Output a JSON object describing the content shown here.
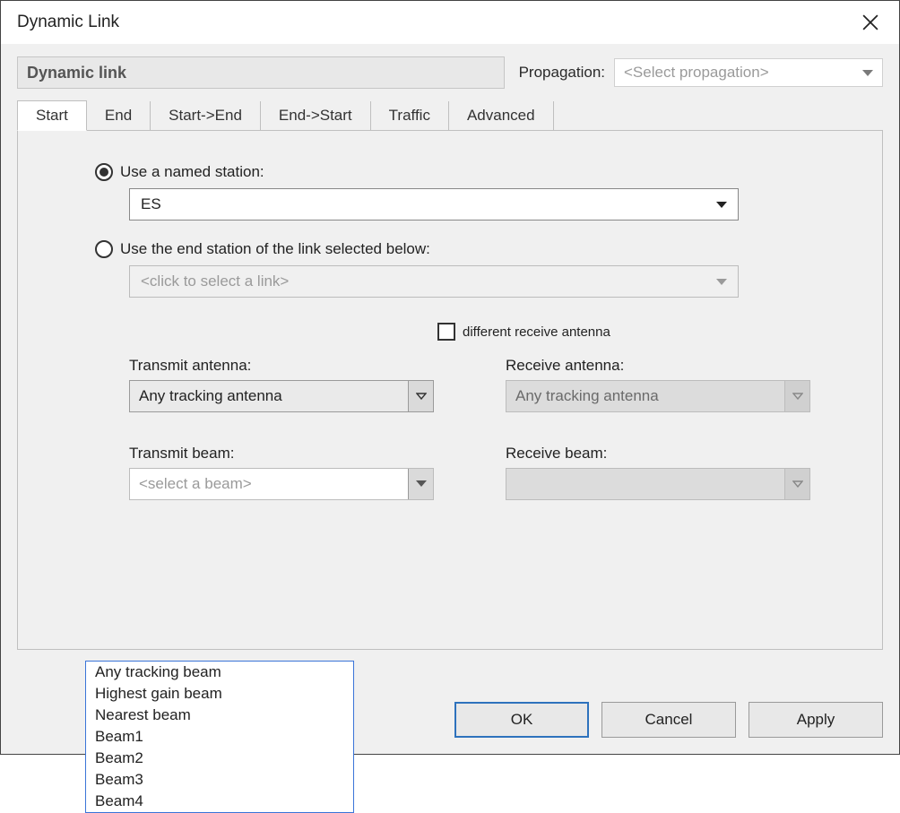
{
  "window": {
    "title": "Dynamic Link"
  },
  "header": {
    "name_value": "Dynamic link",
    "propagation_label": "Propagation:",
    "propagation_placeholder": "<Select propagation>"
  },
  "tabs": [
    "Start",
    "End",
    "Start->End",
    "End->Start",
    "Traffic",
    "Advanced"
  ],
  "active_tab": 0,
  "start": {
    "radio_named_label": "Use a named station:",
    "station_value": "ES",
    "radio_endlink_label": "Use the end station of the link selected below:",
    "link_placeholder": "<click to select a link>",
    "different_rx_label": "different receive antenna",
    "tx_antenna_label": "Transmit antenna:",
    "tx_antenna_value": "Any tracking antenna",
    "rx_antenna_label": "Receive antenna:",
    "rx_antenna_value": "Any tracking antenna",
    "tx_beam_label": "Transmit beam:",
    "tx_beam_placeholder": "<select a beam>",
    "rx_beam_label": "Receive beam:",
    "tx_beam_options": [
      "Any tracking beam",
      "Highest gain beam",
      "Nearest beam",
      "Beam1",
      "Beam2",
      "Beam3",
      "Beam4"
    ]
  },
  "buttons": {
    "ok": "OK",
    "cancel": "Cancel",
    "apply": "Apply"
  }
}
